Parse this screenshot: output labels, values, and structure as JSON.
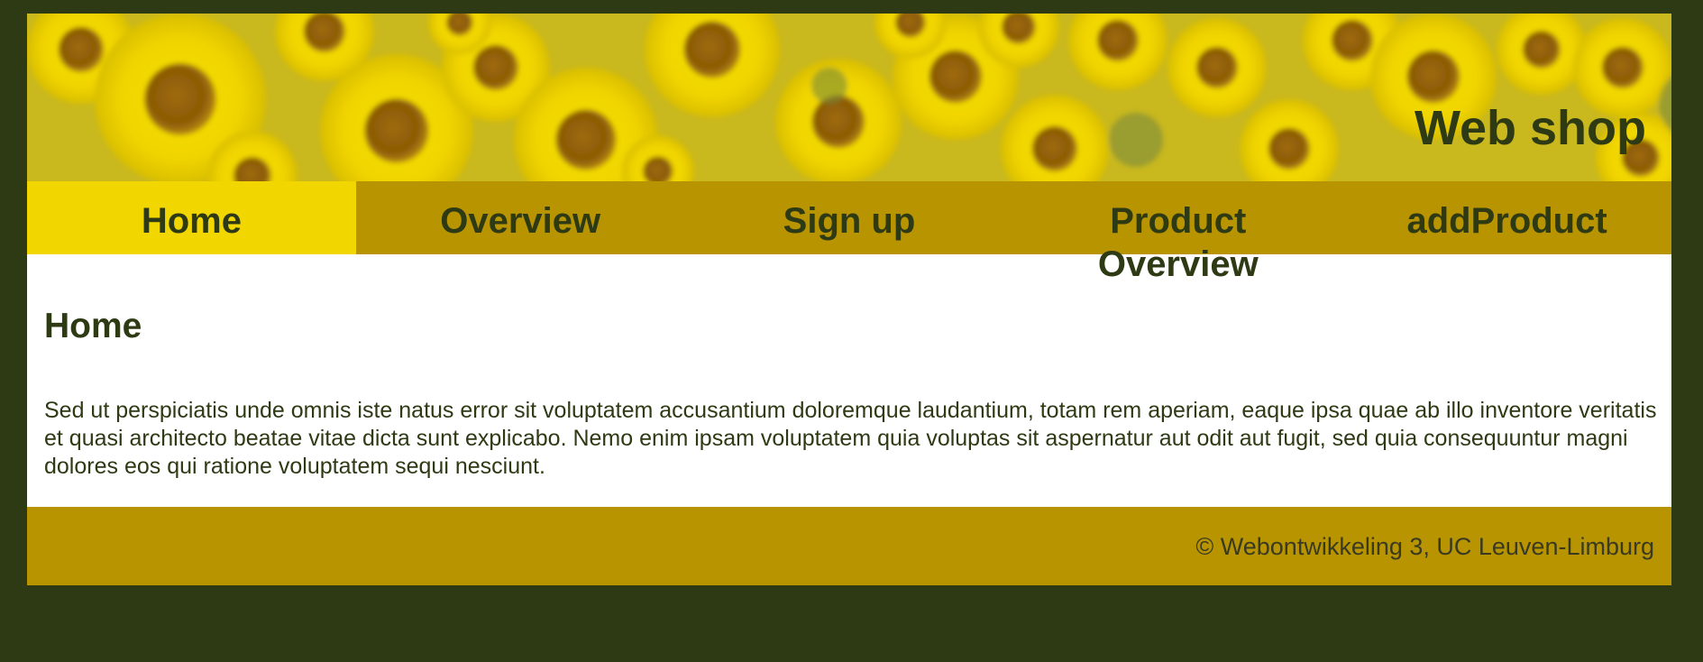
{
  "header": {
    "site_title": "Web shop",
    "banner_image": "sunflower-field"
  },
  "nav": {
    "items": [
      {
        "label": "Home",
        "active": true
      },
      {
        "label": "Overview",
        "active": false
      },
      {
        "label": "Sign up",
        "active": false
      },
      {
        "label": "Product Overview",
        "active": false
      },
      {
        "label": "addProduct",
        "active": false
      }
    ]
  },
  "main": {
    "heading": "Home",
    "paragraph": "Sed ut perspiciatis unde omnis iste natus error sit voluptatem accusantium doloremque laudantium, totam rem aperiam, eaque ipsa quae ab illo inventore veritatis et quasi architecto beatae vitae dicta sunt explicabo. Nemo enim ipsam voluptatem quia voluptas sit aspernatur aut odit aut fugit, sed quia consequuntur magni dolores eos qui ratione voluptatem sequi nesciunt."
  },
  "footer": {
    "copyright": "© Webontwikkeling 3, UC Leuven-Limburg"
  },
  "colors": {
    "page_background": "#2e3a14",
    "nav_background": "#b89400",
    "nav_active": "#f2d600",
    "text_dark": "#2e3a14",
    "content_background": "#ffffff"
  }
}
